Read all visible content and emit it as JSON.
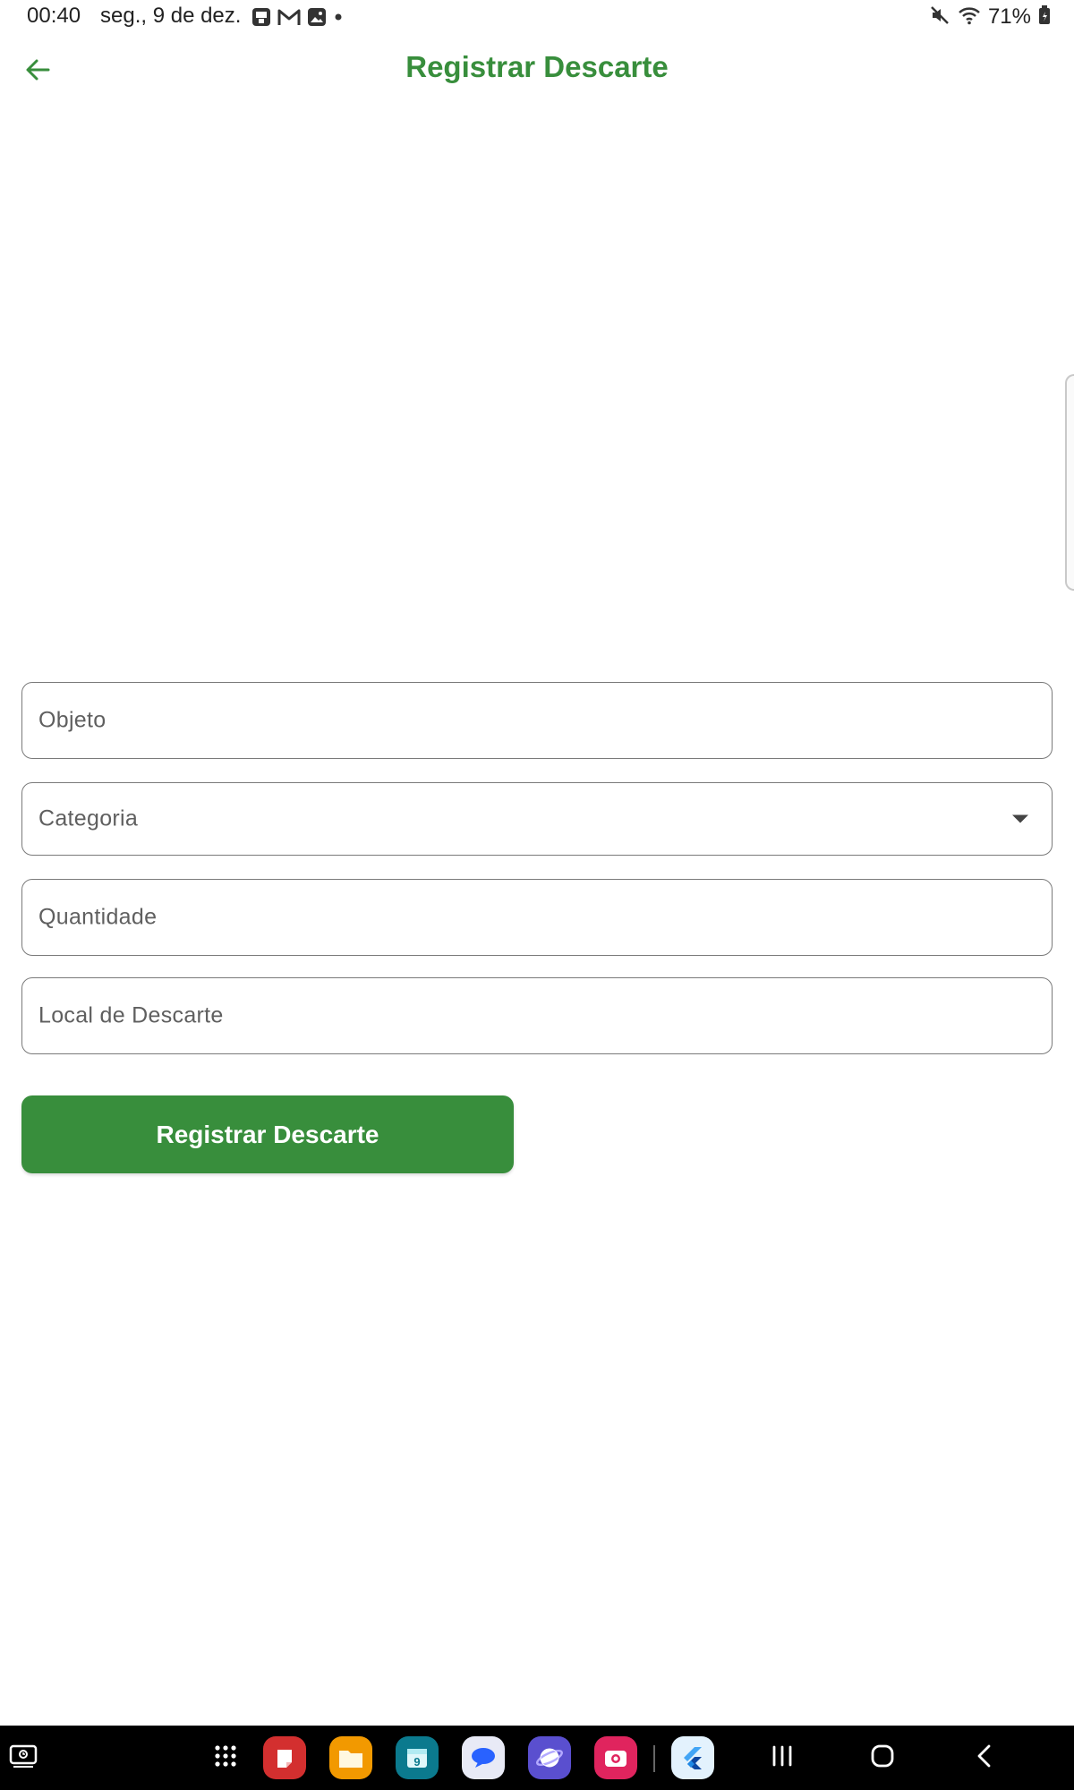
{
  "status_bar": {
    "time": "00:40",
    "date": "seg., 9 de dez.",
    "battery": "71%",
    "notification_icons": [
      "photo-store-icon",
      "gmail-icon",
      "gallery-icon",
      "more-dot-icon"
    ],
    "system_icons": [
      "mute-icon",
      "wifi-icon",
      "battery-icon"
    ]
  },
  "app_bar": {
    "title": "Registrar Descarte",
    "back_icon": "arrow-back-icon"
  },
  "form": {
    "objeto_placeholder": "Objeto",
    "categoria_placeholder": "Categoria",
    "quantidade_placeholder": "Quantidade",
    "local_placeholder": "Local de Descarte",
    "submit_label": "Registrar Descarte"
  },
  "nav_bar": {
    "apps": [
      {
        "name": "app-drawer-icon"
      },
      {
        "name": "notes-app-icon",
        "color": "#d32f2f"
      },
      {
        "name": "files-app-icon",
        "color": "#f29900"
      },
      {
        "name": "calendar-app-icon",
        "color": "#0b7a8e",
        "label": "9"
      },
      {
        "name": "messages-app-icon",
        "color": "#e8eaf6"
      },
      {
        "name": "internet-app-icon",
        "color": "#5a4fcf"
      },
      {
        "name": "camera-app-icon",
        "color": "#e0245e"
      },
      {
        "name": "flutter-app-icon",
        "color": "#e3f2fd"
      }
    ],
    "buttons": [
      "recents-button",
      "home-button",
      "back-button"
    ]
  },
  "colors": {
    "accent": "#388E3C",
    "field_border": "#7a7a7a",
    "nav_background": "#000000"
  }
}
